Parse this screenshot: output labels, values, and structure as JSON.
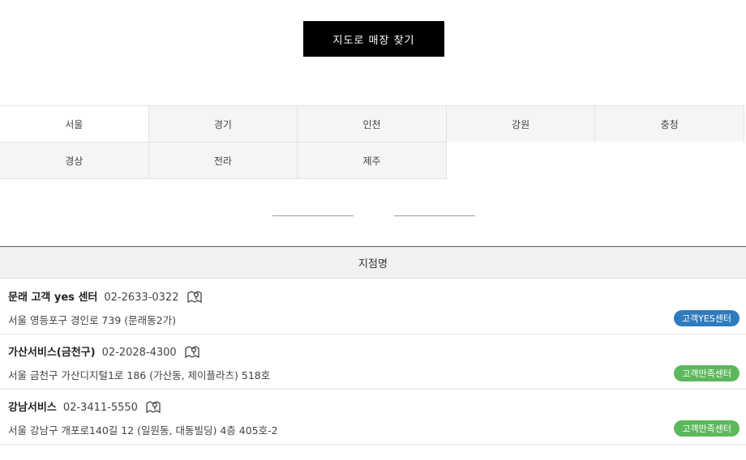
{
  "map_button_label": "지도로 매장 찾기",
  "regions": [
    "서울",
    "경기",
    "인천",
    "강원",
    "충청",
    "경상",
    "전라",
    "제주"
  ],
  "list_header": "지점명",
  "stores": [
    {
      "name": "문래 고객 yes 센터",
      "phone": "02-2633-0322",
      "address": "서울 영등포구 경인로 739 (문래동2가)",
      "badge": "고객YES센터",
      "badge_color": "#2f7bbd"
    },
    {
      "name": "가산서비스(금천구)",
      "phone": "02-2028-4300",
      "address": "서울 금천구 가산디지털1로 186 (가산동, 제이플라츠) 518호",
      "badge": "고객만족센터",
      "badge_color": "#5cb85c"
    },
    {
      "name": "강남서비스",
      "phone": "02-3411-5550",
      "address": "서울 강남구 개포로140길 12 (일원동, 대동빌딩) 4층 405호-2",
      "badge": "고객만족센터",
      "badge_color": "#5cb85c"
    }
  ]
}
